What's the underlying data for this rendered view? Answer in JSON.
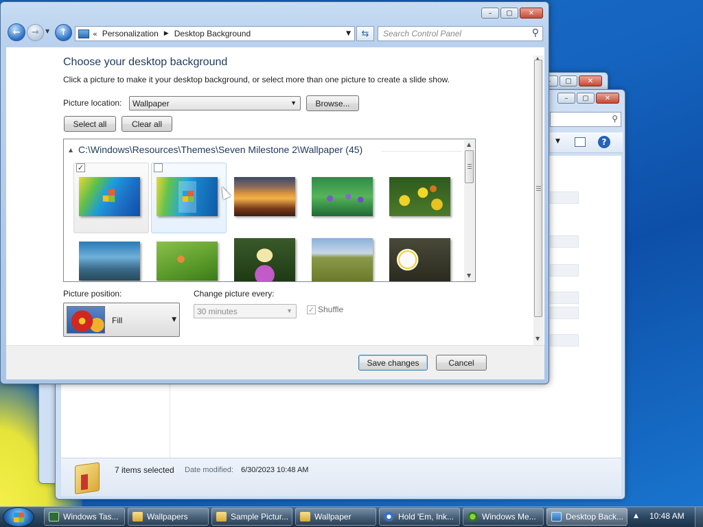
{
  "window": {
    "breadcrumb_parent": "Personalization",
    "breadcrumb_current": "Desktop Background",
    "search_placeholder": "Search Control Panel"
  },
  "content": {
    "heading": "Choose your desktop background",
    "instructions": "Click a picture to make it your desktop background, or select more than one picture to create a slide show.",
    "picture_location_label": "Picture location:",
    "picture_location_value": "Wallpaper",
    "browse_label": "Browse...",
    "select_all_label": "Select all",
    "clear_all_label": "Clear all",
    "group_header": "C:\\Windows\\Resources\\Themes\\Seven Milestone 2\\Wallpaper (45)",
    "picture_position_label": "Picture position:",
    "picture_position_value": "Fill",
    "change_picture_label": "Change picture every:",
    "change_picture_value": "30 minutes",
    "shuffle_label": "Shuffle",
    "save_label": "Save changes",
    "cancel_label": "Cancel"
  },
  "thumbnails": [
    {
      "name": "windows-logo-blue",
      "checked": true,
      "selected": true
    },
    {
      "name": "windows-logo-fish",
      "checked": false,
      "hovered": true
    },
    {
      "name": "sunset-sea"
    },
    {
      "name": "purple-flowers"
    },
    {
      "name": "yellow-flowers-butterfly"
    },
    {
      "name": "rocky-shore"
    },
    {
      "name": "green-plant"
    },
    {
      "name": "butterfly-purple-flower"
    },
    {
      "name": "field-path"
    },
    {
      "name": "white-flower"
    }
  ],
  "background_explorer": {
    "status_count": "7 items selected",
    "status_date_label": "Date modified:",
    "status_date_value": "6/30/2023 10:48 AM"
  },
  "taskbar": {
    "items": [
      {
        "label": "Windows Tas..."
      },
      {
        "label": "Wallpapers"
      },
      {
        "label": "Sample Pictur..."
      },
      {
        "label": "Wallpaper"
      },
      {
        "label": "Hold 'Em, Ink..."
      },
      {
        "label": "Windows Me..."
      },
      {
        "label": "Desktop Back..."
      }
    ],
    "clock": "10:48 AM"
  },
  "colors": {
    "link_blue": "#1e395b",
    "heading_blue": "#1e395b",
    "desktop_blue": "#1565c0"
  }
}
